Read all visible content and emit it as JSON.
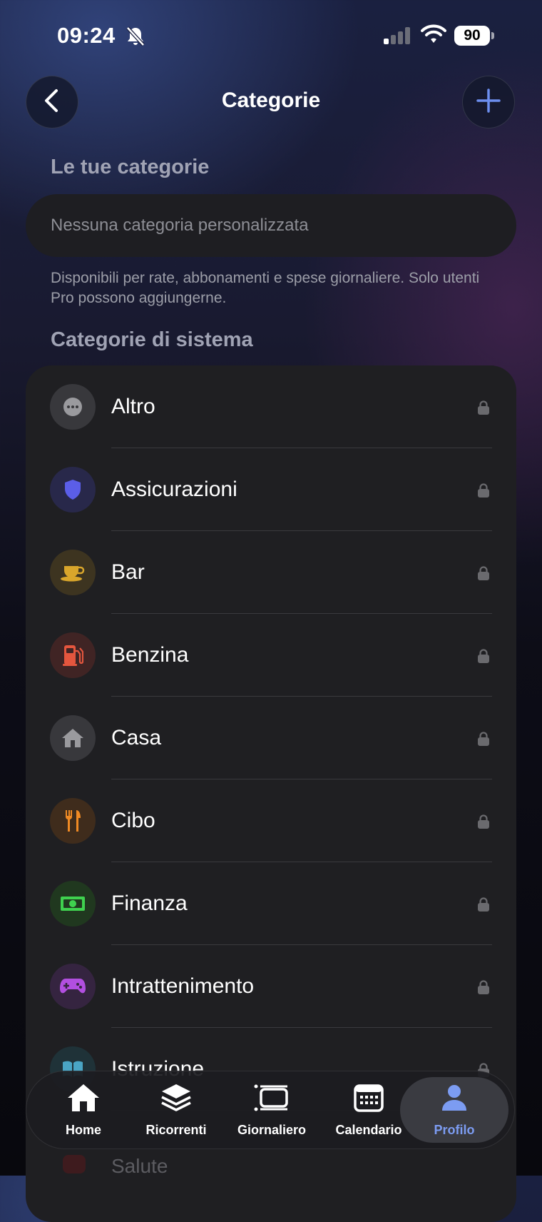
{
  "status_bar": {
    "time": "09:24",
    "battery": "90"
  },
  "header": {
    "title": "Categorie"
  },
  "custom": {
    "heading": "Le tue categorie",
    "empty_text": "Nessuna categoria personalizzata",
    "note": "Disponibili per rate, abbonamenti e spese giornaliere. Solo utenti Pro possono aggiungerne."
  },
  "system": {
    "heading": "Categorie di sistema",
    "items": [
      {
        "label": "Altro",
        "icon": "ellipsis-icon",
        "color": "#9a9a9e"
      },
      {
        "label": "Assicurazioni",
        "icon": "shield-icon",
        "color": "#5b5ee8"
      },
      {
        "label": "Bar",
        "icon": "coffee-cup-icon",
        "color": "#d9a62b"
      },
      {
        "label": "Benzina",
        "icon": "fuel-pump-icon",
        "color": "#e4563e"
      },
      {
        "label": "Casa",
        "icon": "house-icon",
        "color": "#9a9a9e"
      },
      {
        "label": "Cibo",
        "icon": "fork-knife-icon",
        "color": "#f08a24"
      },
      {
        "label": "Finanza",
        "icon": "banknote-icon",
        "color": "#3fd14f"
      },
      {
        "label": "Intrattenimento",
        "icon": "gamepad-icon",
        "color": "#b24fe0"
      },
      {
        "label": "Istruzione",
        "icon": "book-icon",
        "color": "#4aa5c4"
      }
    ],
    "peek_label": "Salute"
  },
  "tabbar": {
    "tabs": [
      {
        "label": "Home",
        "icon": "house-icon"
      },
      {
        "label": "Ricorrenti",
        "icon": "layers-icon"
      },
      {
        "label": "Giornaliero",
        "icon": "list-icon"
      },
      {
        "label": "Calendario",
        "icon": "calendar-icon"
      },
      {
        "label": "Profilo",
        "icon": "person-icon",
        "active": true
      }
    ]
  }
}
